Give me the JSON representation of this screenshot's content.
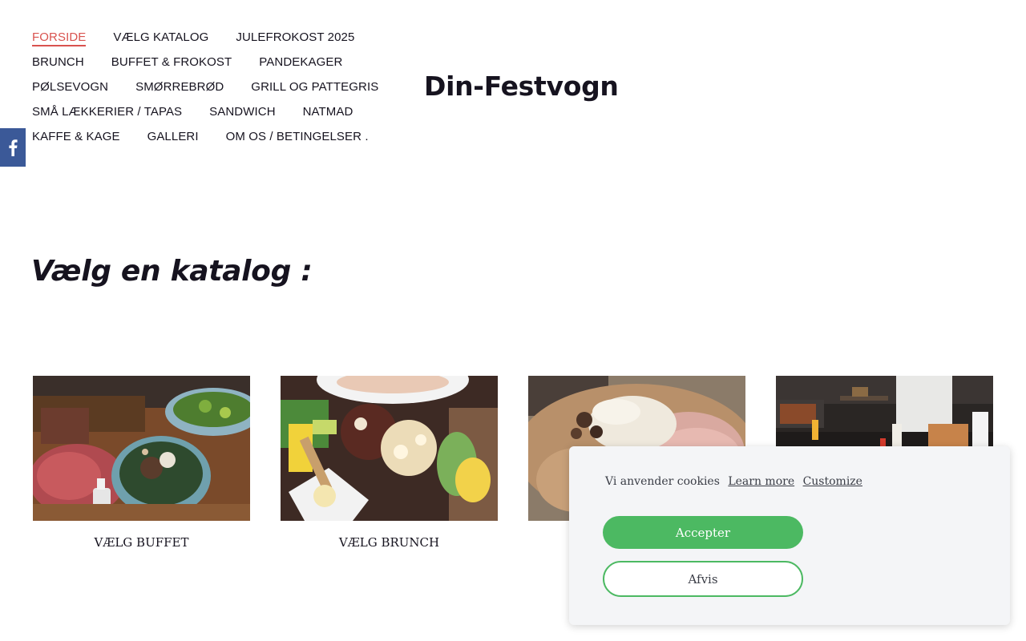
{
  "nav": {
    "rows": [
      [
        "FORSIDE",
        "VÆLG KATALOG",
        "JULEFROKOST 2025"
      ],
      [
        "BRUNCH",
        "BUFFET & FROKOST",
        "PANDEKAGER"
      ],
      [
        "PØLSEVOGN",
        "SMØRREBRØD",
        "GRILL OG PATTEGRIS"
      ],
      [
        "SMÅ LÆKKERIER / TAPAS",
        "SANDWICH",
        "NATMAD"
      ],
      [
        "KAFFE & KAGE",
        "GALLERI",
        "OM OS / BETINGELSER ."
      ]
    ],
    "active": "FORSIDE",
    "active_color": "#d9534f"
  },
  "social": {
    "icon": "facebook-icon",
    "color": "#3b5998"
  },
  "brand": {
    "title": "Din-Festvogn"
  },
  "main": {
    "heading": "Vælg en katalog :",
    "tiles": [
      {
        "caption": "VÆLG BUFFET",
        "image": "buffet-platters-photo"
      },
      {
        "caption": "VÆLG BRUNCH",
        "image": "brunch-salad-photo"
      },
      {
        "caption": "",
        "image": "pancake-ham-cheese-photo"
      },
      {
        "caption": "",
        "image": "food-truck-kitchen-photo"
      }
    ]
  },
  "cookie": {
    "text": "Vi anvender cookies",
    "learn_more": "Learn more",
    "customize": "Customize",
    "accept": "Accepter",
    "reject": "Afvis",
    "accent": "#4cb962"
  }
}
